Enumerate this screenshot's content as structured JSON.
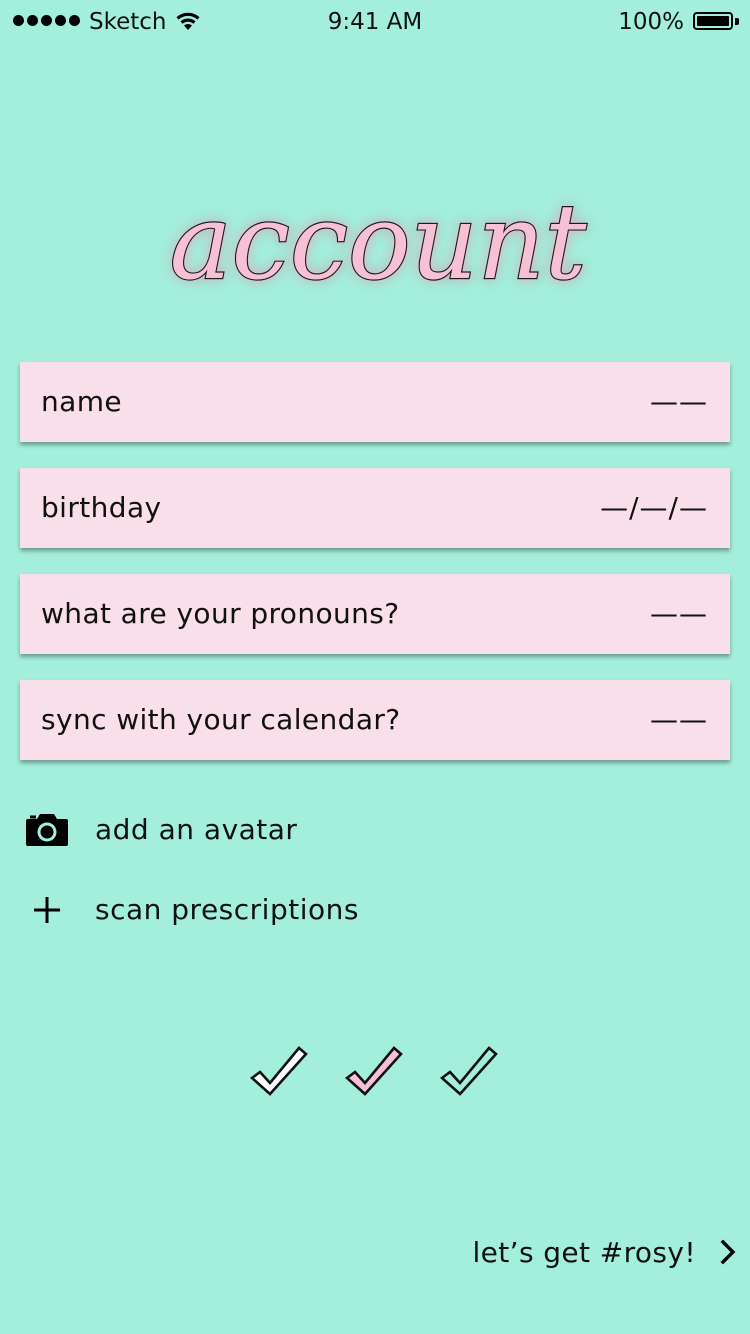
{
  "status_bar": {
    "carrier": "Sketch",
    "time": "9:41 AM",
    "battery_percent": "100%"
  },
  "title": "account",
  "fields": [
    {
      "label": "name",
      "value": "——"
    },
    {
      "label": "birthday",
      "value": "—/—/—"
    },
    {
      "label": "what are your pronouns?",
      "value": "——"
    },
    {
      "label": "sync with your calendar?",
      "value": "——"
    }
  ],
  "actions": {
    "avatar": {
      "label": "add an avatar",
      "icon": "camera-icon"
    },
    "prescriptions": {
      "label": "scan prescriptions",
      "icon": "plus-icon"
    }
  },
  "progress": {
    "steps": [
      {
        "icon": "checkmark-icon",
        "filled": false
      },
      {
        "icon": "checkmark-icon",
        "filled": true
      },
      {
        "icon": "checkmark-icon",
        "filled": false
      }
    ]
  },
  "next": {
    "label": "let’s get #rosy!",
    "icon": "chevron-right-icon"
  },
  "colors": {
    "background": "#a3efdc",
    "field_background": "#f9dfea",
    "accent_pink": "#f7c0d4",
    "text": "#111111"
  }
}
